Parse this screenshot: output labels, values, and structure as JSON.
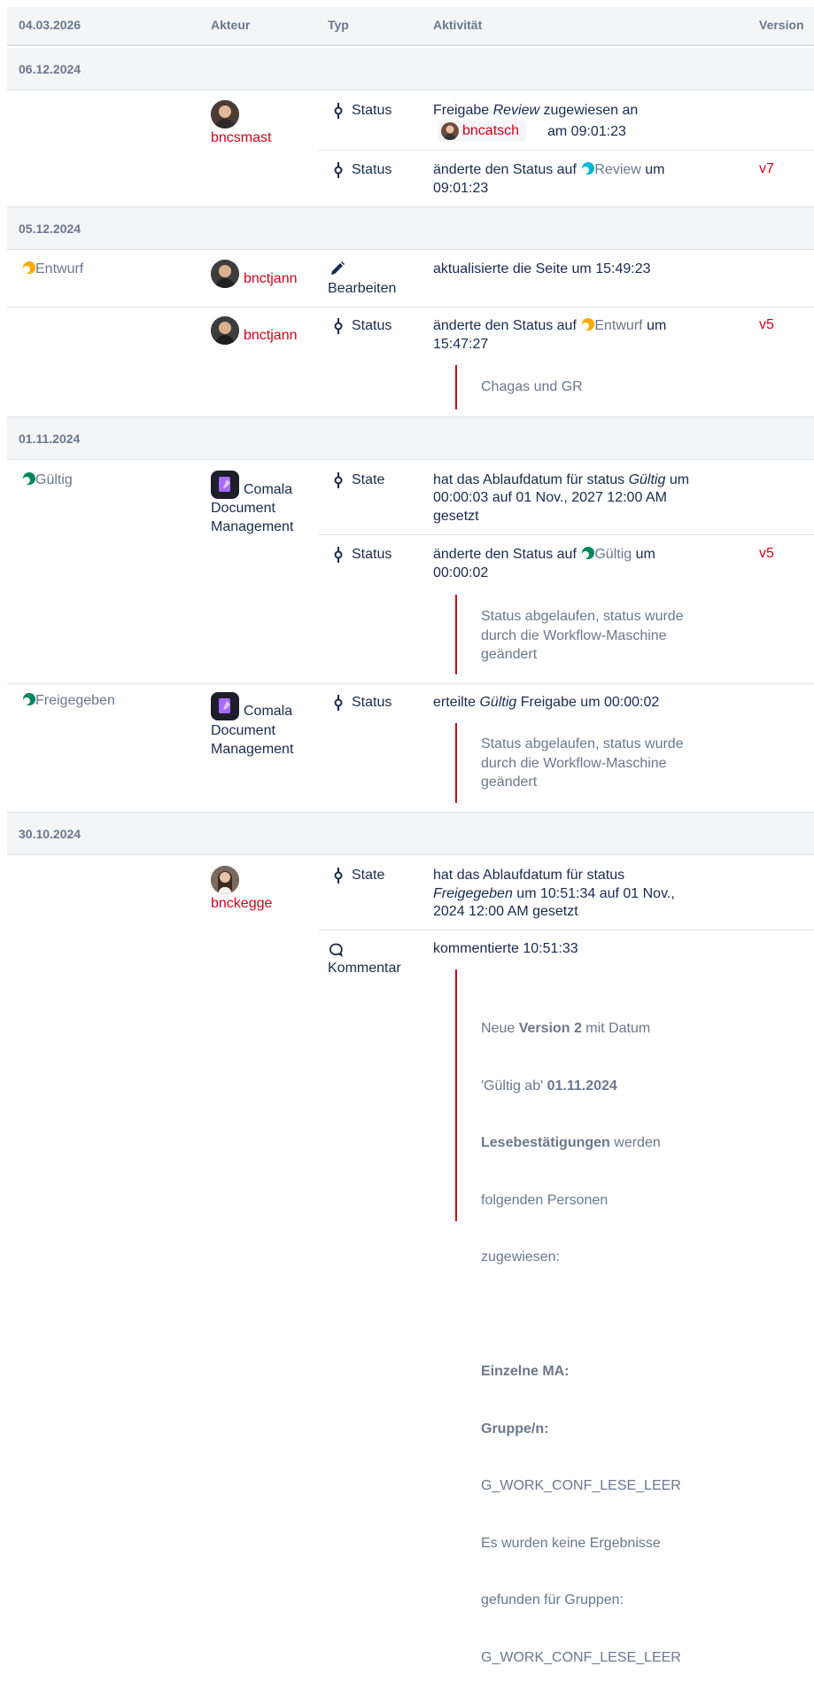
{
  "header": {
    "date": "04.03.2026",
    "actor": "Akteur",
    "type": "Typ",
    "activity": "Aktivität",
    "version": "Version"
  },
  "colors": {
    "link_red": "#d0021b",
    "review": "#00b8d9",
    "draft": "#ffab00",
    "valid": "#00875a",
    "header_bg": "#f4f5f7"
  },
  "groups": [
    {
      "date": "06.12.2024",
      "rows": [
        {
          "actor": "bncsmast",
          "type": "Status",
          "text_a": "Freigabe ",
          "italic": "Review",
          "text_b": " zugewiesen an",
          "chip_user": "bncatsch",
          "text_c": "am 09:01:23"
        },
        {
          "type": "Status",
          "text_a": "änderte den Status auf",
          "status": "Review",
          "status_color": "#00b8d9",
          "text_b": "um",
          "text_c": "09:01:23",
          "version": "v7"
        }
      ]
    },
    {
      "date": "05.12.2024",
      "rows": [
        {
          "state": "Entwurf",
          "state_color": "#ffab00",
          "actor": "bnctjann",
          "type": "Bearbeiten",
          "text_a": "aktualisierte die Seite um 15:49:23"
        },
        {
          "actor": "bnctjann",
          "type": "Status",
          "text_a": "änderte den Status auf",
          "status": "Entwurf",
          "status_color": "#ffab00",
          "text_b": "um",
          "text_c": "15:47:27",
          "version": "v5",
          "comment": "Chagas und GR"
        }
      ]
    },
    {
      "date": "01.11.2024",
      "rows": [
        {
          "state": "Gültig",
          "state_color": "#00875a",
          "actor_l1": "Comala",
          "actor_l2": "Document",
          "actor_l3": "Management",
          "type": "State",
          "text_a": "hat das Ablaufdatum für status ",
          "italic": "Gültig",
          "text_b": " um",
          "text_c": "00:00:03 auf 01 Nov., 2027 12:00 AM",
          "text_d": "gesetzt"
        },
        {
          "type": "Status",
          "text_a": "änderte den Status auf",
          "status": "Gültig",
          "status_color": "#00875a",
          "text_b": "um",
          "text_c": "00:00:02",
          "version": "v5",
          "comment_l1": "Status abgelaufen, status wurde",
          "comment_l2": "durch die Workflow-Maschine",
          "comment_l3": "geändert"
        },
        {
          "state": "Freigegeben",
          "state_color": "#00875a",
          "actor_l1": "Comala",
          "actor_l2": "Document",
          "actor_l3": "Management",
          "type": "Status",
          "text_a": "erteilte ",
          "italic": "Gültig",
          "text_b": " Freigabe um 00:00:02",
          "comment_l1": "Status abgelaufen, status wurde",
          "comment_l2": "durch die Workflow-Maschine",
          "comment_l3": "geändert"
        }
      ]
    },
    {
      "date": "30.10.2024",
      "rows": [
        {
          "actor": "bnckegge",
          "type": "State",
          "text_a": "hat das Ablaufdatum für status",
          "italic": "Freigegeben",
          "text_b": " um 10:51:34 auf 01 Nov.,",
          "text_c": "2024 12:00 AM gesetzt"
        },
        {
          "type": "Kommentar",
          "text_a": "kommentierte 10:51:33",
          "comment": {
            "p1_a": "Neue ",
            "p1_b": "Version 2",
            "p1_c": " mit Datum",
            "p2_a": "'Gültig ab' ",
            "p2_b": "01.11.2024",
            "p3_b": "Lesebestätigungen",
            "p3_c": " werden",
            "p4": "folgenden Personen",
            "p5": "zugewiesen:",
            "h1": "Einzelne MA:",
            "h2": "Gruppe/n:",
            "g1": "G_WORK_CONF_LESE_LEER",
            "g2": "Es wurden keine Ergebnisse",
            "g3": "gefunden für Gruppen:",
            "g4": "G_WORK_CONF_LESE_LEER"
          }
        }
      ]
    }
  ]
}
